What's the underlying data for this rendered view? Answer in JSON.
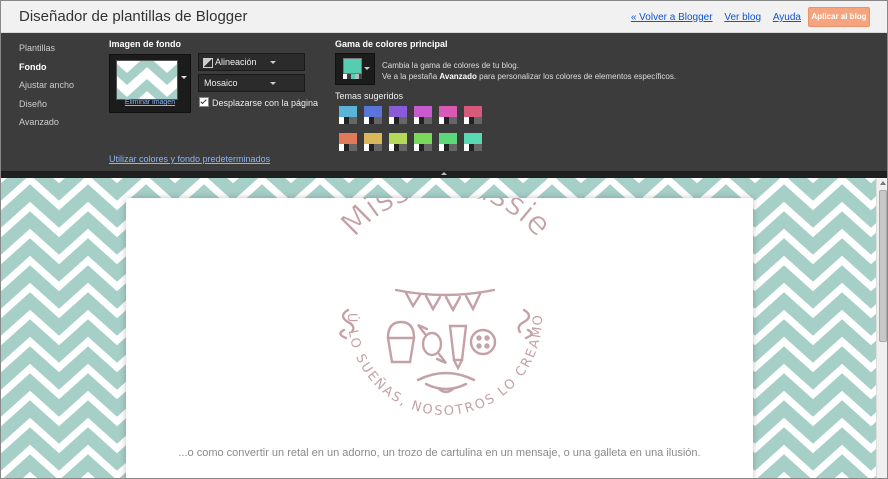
{
  "app": {
    "title": "Diseñador de plantillas de Blogger",
    "links": {
      "back": "« Volver a Blogger",
      "view": "Ver blog",
      "help": "Ayuda"
    },
    "apply_button": "Aplicar al blog"
  },
  "nav": {
    "items": [
      {
        "label": "Plantillas",
        "active": false
      },
      {
        "label": "Fondo",
        "active": true
      },
      {
        "label": "Ajustar ancho",
        "active": false
      },
      {
        "label": "Diseño",
        "active": false
      },
      {
        "label": "Avanzado",
        "active": false
      }
    ]
  },
  "background": {
    "section_title": "Imagen de fondo",
    "remove_link": "Eliminar imagen",
    "alignment_label": "Alineación",
    "tiling_value": "Mosaico",
    "scroll_checkbox": {
      "label": "Desplazarse con la página",
      "checked": true
    },
    "defaults_link": "Utilizar colores y fondo predeterminados"
  },
  "colors": {
    "section_title": "Gama de colores principal",
    "selected_color": "#56ccb0",
    "description_line1": "Cambia la gama de colores de tu blog.",
    "description_line2_pre": "Ve a la pestaña ",
    "description_line2_bold": "Avanzado",
    "description_line2_post": " para personalizar los colores de elementos específicos.",
    "suggested_title": "Temas sugeridos",
    "themes": [
      "#5ab4d8",
      "#5a74d8",
      "#8a5ad8",
      "#c85ad0",
      "#d85ab4",
      "#d85a7a",
      "#e07a5a",
      "#d8b85a",
      "#b4d85a",
      "#7ad85a",
      "#5ad87a",
      "#5ad8b4"
    ]
  },
  "blog": {
    "pattern_color": "#a6cfc8",
    "logo_title": "Miss Moussie",
    "logo_ring_text": "TÚ LO SUEÑAS, NOSOTROS LO CREAMOS",
    "logo_color": "#c4a1a6",
    "tagline": "...o como convertir un retal en un adorno, un trozo de cartulina en un mensaje, o una galleta en una ilusión."
  }
}
